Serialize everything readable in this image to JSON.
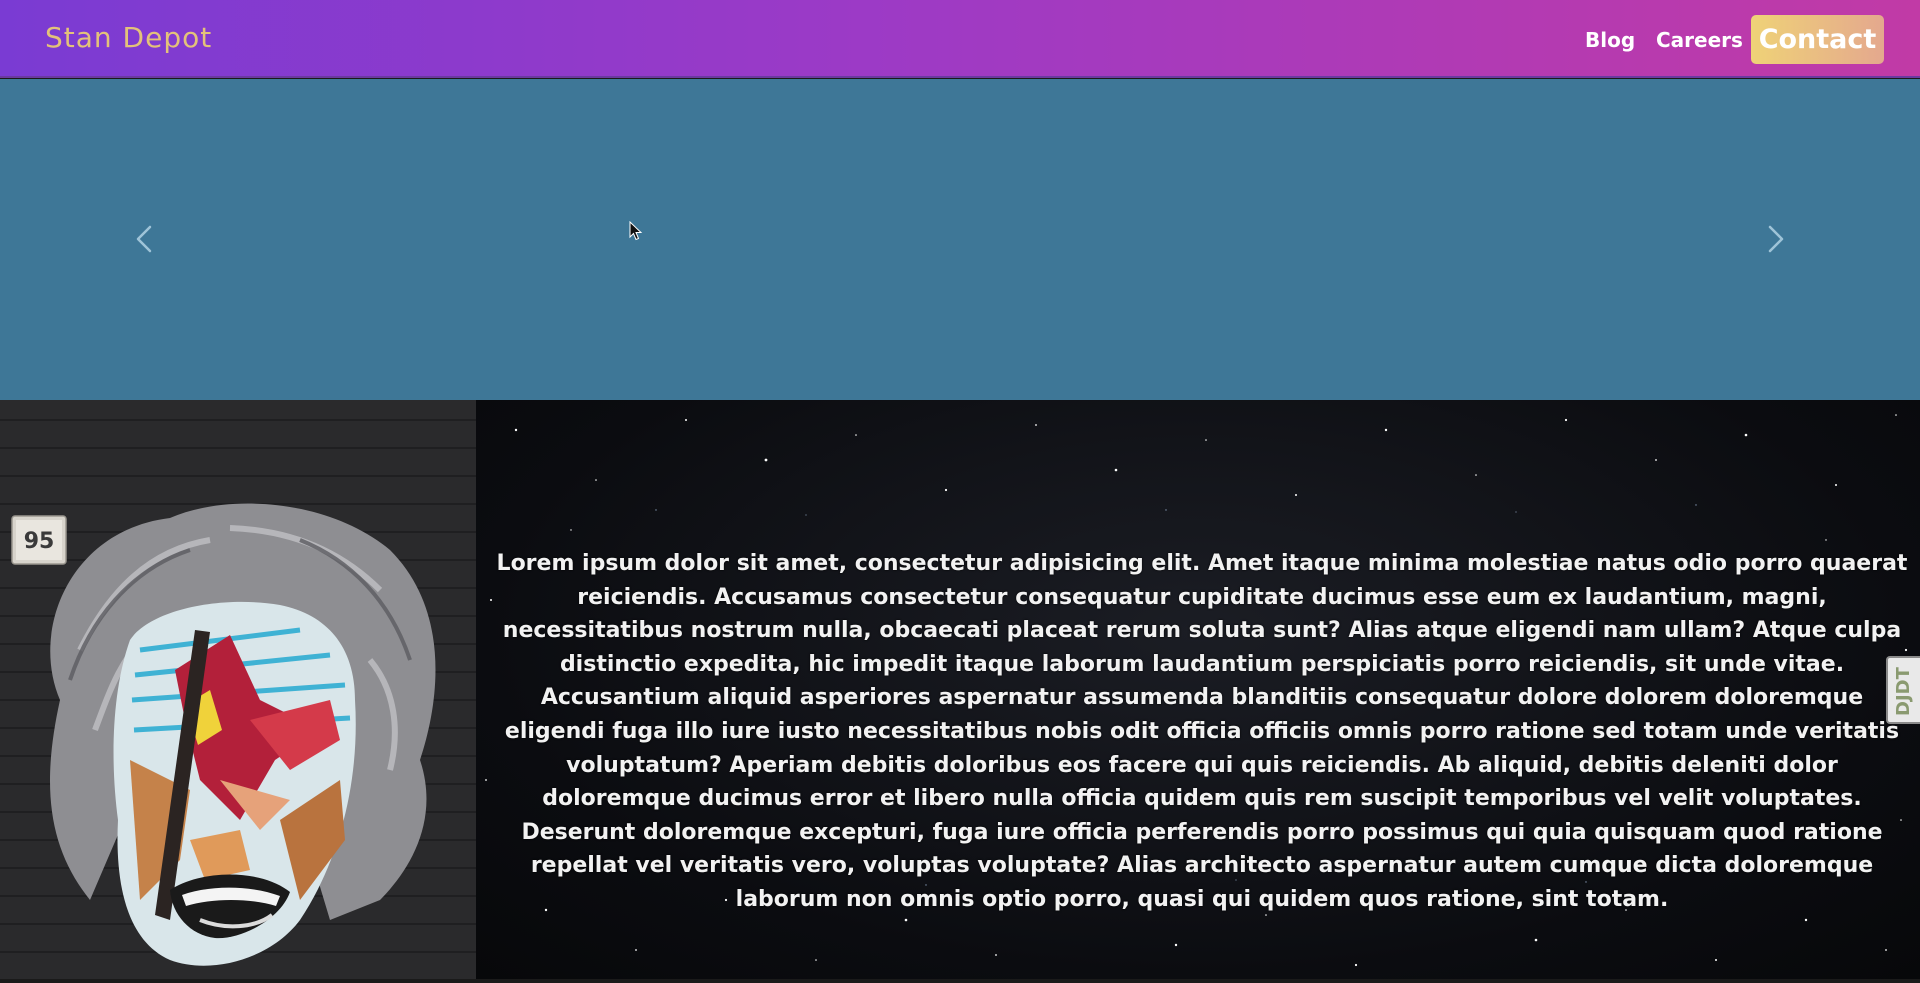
{
  "navbar": {
    "brand": "Stan Depot",
    "links": {
      "blog": "Blog",
      "careers": "Careers",
      "contact": "Contact"
    }
  },
  "carousel": {
    "prev_icon": "chevron-left-icon",
    "next_icon": "chevron-right-icon",
    "background_color": "#3e7797"
  },
  "art": {
    "house_number": "95"
  },
  "content": {
    "body_text": "Lorem ipsum dolor sit amet, consectetur adipisicing elit. Amet itaque minima molestiae natus odio porro quaerat reiciendis. Accusamus consectetur consequatur cupiditate ducimus esse eum ex laudantium, magni, necessitatibus nostrum nulla, obcaecati placeat rerum soluta sunt? Alias atque eligendi nam ullam? Atque culpa distinctio expedita, hic impedit itaque laborum laudantium perspiciatis porro reiciendis, sit unde vitae. Accusantium aliquid asperiores aspernatur assumenda blanditiis consequatur dolore dolorem doloremque eligendi fuga illo iure iusto necessitatibus nobis odit officia officiis omnis porro ratione sed totam unde veritatis voluptatum? Aperiam debitis doloribus eos facere qui quis reiciendis. Ab aliquid, debitis deleniti dolor doloremque ducimus error et libero nulla officia quidem quis rem suscipit temporibus vel velit voluptates. Deserunt doloremque excepturi, fuga iure officia perferendis porro possimus qui quia quisquam quod ratione repellat vel veritatis vero, voluptas voluptate? Alias architecto aspernatur autem cumque dicta doloremque laborum non omnis optio porro, quasi qui quidem quos ratione, sint totam."
  },
  "debug_toolbar": {
    "label": "DJDT"
  },
  "colors": {
    "nav_gradient_start": "#7a3bd3",
    "nav_gradient_end": "#c13aa6",
    "brand_color": "#e3c27a",
    "contact_gradient_start": "#efd277",
    "contact_gradient_end": "#e4a88e"
  }
}
